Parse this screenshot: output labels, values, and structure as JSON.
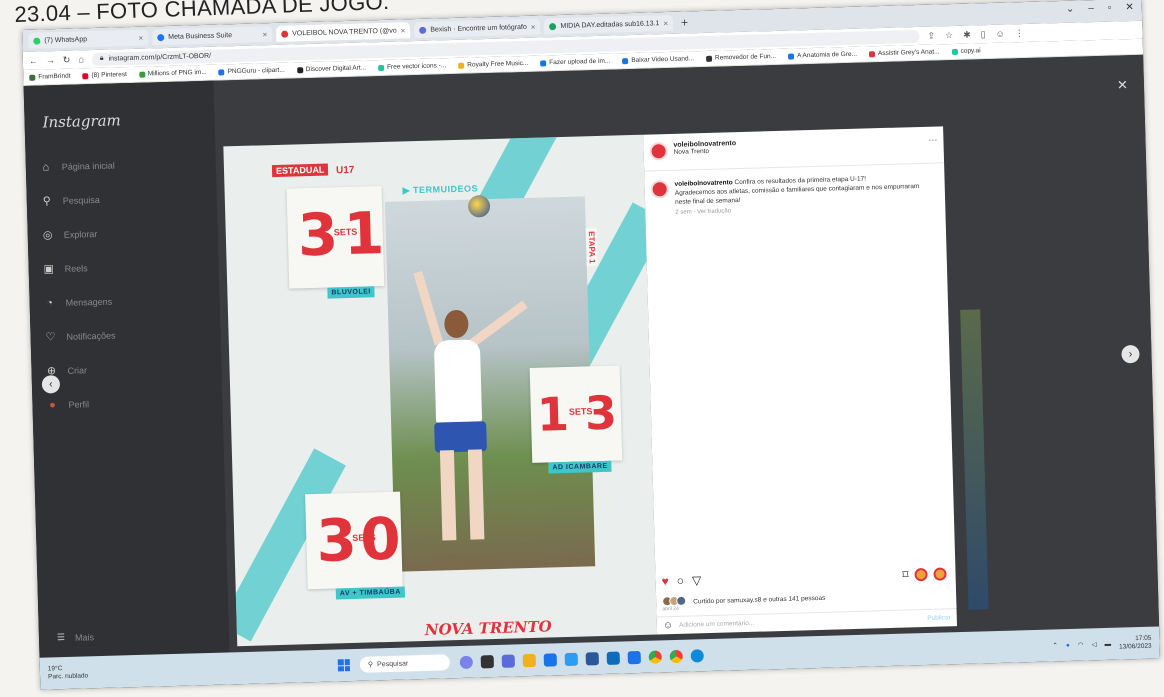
{
  "heading": "23.04 – FOTO CHAMADA DE JOGO.",
  "browser": {
    "tabs": [
      {
        "label": "(7) WhatsApp",
        "color": "#25d366"
      },
      {
        "label": "Meta Business Suite",
        "color": "#1877f2"
      },
      {
        "label": "VOLEIBOL NOVA TRENTO (@vo",
        "color": "#e0343d",
        "active": true
      },
      {
        "label": "Bexish · Encontre um fotógrafo",
        "color": "#5b6bd8"
      },
      {
        "label": "MIDIA DAY.editadas sub16.13.1",
        "color": "#1aa260"
      }
    ],
    "new_tab": "+",
    "url": "instagram.com/p/CrzmLT-OBOR/",
    "bookmarks": [
      {
        "label": "FramBrindt",
        "color": "#3b6e3a"
      },
      {
        "label": "(8) Pinterest",
        "color": "#e60023"
      },
      {
        "label": "Millions of PNG im...",
        "color": "#3a9d3a"
      },
      {
        "label": "PNGGuru - clipart...",
        "color": "#1a73e8"
      },
      {
        "label": "Discover Digital Art...",
        "color": "#222222"
      },
      {
        "label": "Free vector icons -...",
        "color": "#22c4a3"
      },
      {
        "label": "Royalty Free Music...",
        "color": "#f2b01e"
      },
      {
        "label": "Fazer upload de im...",
        "color": "#1a73e8"
      },
      {
        "label": "Baixar Video Usand...",
        "color": "#1a73e8"
      },
      {
        "label": "Removedor de Fun...",
        "color": "#333333"
      },
      {
        "label": "A Anatomia de Gre...",
        "color": "#1a73e8"
      },
      {
        "label": "Assistir Grey's Anat...",
        "color": "#e0343d"
      },
      {
        "label": "copy.ai",
        "color": "#22c4a3"
      }
    ]
  },
  "instagram": {
    "logo": "Instagram",
    "nav": [
      {
        "label": "Página inicial",
        "icon": "⌂"
      },
      {
        "label": "Pesquisa",
        "icon": "⚲"
      },
      {
        "label": "Explorar",
        "icon": "◎"
      },
      {
        "label": "Reels",
        "icon": "▣"
      },
      {
        "label": "Mensagens",
        "icon": "◔"
      },
      {
        "label": "Notificações",
        "icon": "♡"
      },
      {
        "label": "Criar",
        "icon": "⊕"
      },
      {
        "label": "Perfil",
        "icon": "●"
      }
    ],
    "more": "Mais",
    "post": {
      "account": "voleibolnovatrento",
      "location": "Nova Trento",
      "caption_user": "voleibolnovatrento",
      "caption_text": "Confira os resultados da primeira etapa U-17!",
      "caption_more": "Agradecemos aos atletas, comissão e familiares que contagiaram e nos empurraram neste final de semana!",
      "time": "2 sem",
      "translate": "Ver tradução",
      "liked_by": "Curtido por samuxay.s8 e outras 141 pessoas",
      "date": "abril 24",
      "comment_placeholder": "Adicione um comentário...",
      "publish": "Publicar"
    },
    "graphic": {
      "etapa_label": "ESTADUAL",
      "category": "U17",
      "sponsor": "TERMUIDEOS",
      "etapa_vertical": "ETAPA 1",
      "sets_label": "SETS",
      "scores": [
        {
          "left": "3",
          "right": "1",
          "team": "BLUVOLEI"
        },
        {
          "left": "1",
          "right": "3",
          "team": "AD ICAMBARE"
        },
        {
          "left": "3",
          "right": "0",
          "team": "AV + TIMBAÚBA"
        }
      ],
      "club_logo": "NOVA TRENTO"
    }
  },
  "taskbar": {
    "temp": "19°C",
    "weather": "Parc. nublado",
    "search": "Pesquisar",
    "time": "17:05",
    "date": "13/06/2023"
  }
}
